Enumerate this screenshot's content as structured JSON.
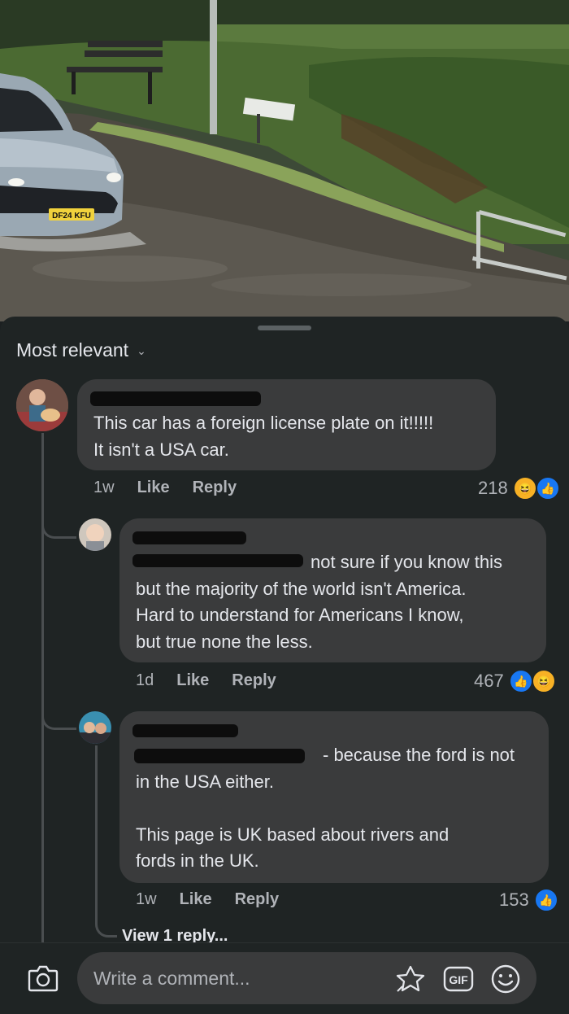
{
  "sort": {
    "label": "Most relevant"
  },
  "composer": {
    "placeholder": "Write a comment..."
  },
  "photo": {
    "plate_text": "DF24 KFU"
  },
  "comments": [
    {
      "text": "This car has a foreign license plate on it!!!!!\nIt isn't a USA car.",
      "time": "1w",
      "like": "Like",
      "reply": "Reply",
      "reaction_count": "218",
      "reactions": [
        "haha",
        "like"
      ]
    },
    {
      "text": "not sure if you know this\nbut the majority of the world isn't America.\nHard to understand for Americans I know,\nbut true none the less.",
      "time": "1d",
      "like": "Like",
      "reply": "Reply",
      "reaction_count": "467",
      "reactions": [
        "like",
        "haha"
      ]
    },
    {
      "text": "- because the ford is not\nin the USA either.\n\nThis page is UK based about rivers and\nfords in the UK.",
      "time": "1w",
      "like": "Like",
      "reply": "Reply",
      "reaction_count": "153",
      "reactions": [
        "like"
      ]
    }
  ],
  "view_replies": "View 1 reply...",
  "colors": {
    "background": "#1f2424",
    "bubble": "#3a3b3c",
    "like_blue": "#1877f2",
    "haha_yellow": "#f7b125"
  }
}
